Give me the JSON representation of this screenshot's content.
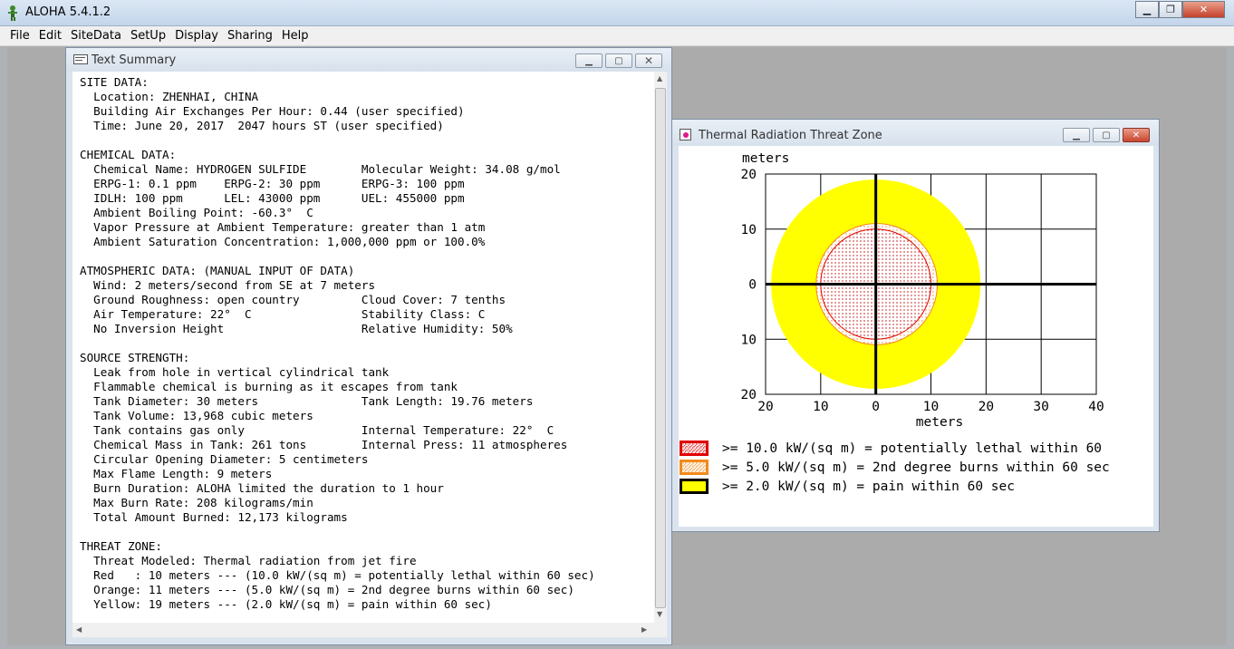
{
  "app": {
    "title": "ALOHA 5.4.1.2",
    "menu": [
      "File",
      "Edit",
      "SiteData",
      "SetUp",
      "Display",
      "Sharing",
      "Help"
    ]
  },
  "text_summary": {
    "title": "Text Summary",
    "lines": [
      "SITE DATA:",
      "  Location: ZHENHAI, CHINA",
      "  Building Air Exchanges Per Hour: 0.44 (user specified)",
      "  Time: June 20, 2017  2047 hours ST (user specified)",
      "",
      "CHEMICAL DATA:",
      "  Chemical Name: HYDROGEN SULFIDE        Molecular Weight: 34.08 g/mol",
      "  ERPG-1: 0.1 ppm    ERPG-2: 30 ppm      ERPG-3: 100 ppm",
      "  IDLH: 100 ppm      LEL: 43000 ppm      UEL: 455000 ppm",
      "  Ambient Boiling Point: -60.3°  C",
      "  Vapor Pressure at Ambient Temperature: greater than 1 atm",
      "  Ambient Saturation Concentration: 1,000,000 ppm or 100.0%",
      "",
      "ATMOSPHERIC DATA: (MANUAL INPUT OF DATA)",
      "  Wind: 2 meters/second from SE at 7 meters",
      "  Ground Roughness: open country         Cloud Cover: 7 tenths",
      "  Air Temperature: 22°  C                Stability Class: C",
      "  No Inversion Height                    Relative Humidity: 50%",
      "",
      "SOURCE STRENGTH:",
      "  Leak from hole in vertical cylindrical tank",
      "  Flammable chemical is burning as it escapes from tank",
      "  Tank Diameter: 30 meters               Tank Length: 19.76 meters",
      "  Tank Volume: 13,968 cubic meters",
      "  Tank contains gas only                 Internal Temperature: 22°  C",
      "  Chemical Mass in Tank: 261 tons        Internal Press: 11 atmospheres",
      "  Circular Opening Diameter: 5 centimeters",
      "  Max Flame Length: 9 meters",
      "  Burn Duration: ALOHA limited the duration to 1 hour",
      "  Max Burn Rate: 208 kilograms/min",
      "  Total Amount Burned: 12,173 kilograms",
      "",
      "THREAT ZONE:",
      "  Threat Modeled: Thermal radiation from jet fire",
      "  Red   : 10 meters --- (10.0 kW/(sq m) = potentially lethal within 60 sec)",
      "  Orange: 11 meters --- (5.0 kW/(sq m) = 2nd degree burns within 60 sec)",
      "  Yellow: 19 meters --- (2.0 kW/(sq m) = pain within 60 sec)"
    ]
  },
  "thermal": {
    "title": "Thermal Radiation Threat Zone",
    "legend": [
      {
        "label": ">= 10.0 kW/(sq m) = potentially lethal within 60",
        "border": "#e00000",
        "fill": "dots-red"
      },
      {
        "label": ">= 5.0 kW/(sq m) = 2nd degree burns within 60 sec",
        "border": "#f28a1c",
        "fill": "dots-orange"
      },
      {
        "label": ">= 2.0 kW/(sq m) = pain within 60 sec",
        "border": "#000000",
        "fill": "#ffff00"
      }
    ]
  },
  "chart_data": {
    "type": "scatter",
    "title": "",
    "xlabel": "meters",
    "ylabel": "meters",
    "xlim": [
      -20,
      40
    ],
    "ylim": [
      -20,
      20
    ],
    "x_ticks": [
      "20",
      "10",
      "0",
      "10",
      "20",
      "30",
      "40"
    ],
    "y_ticks": [
      "20",
      "10",
      "0",
      "10",
      "20"
    ],
    "grid": true,
    "zones": [
      {
        "name": "Red",
        "radius_m": 10,
        "center": [
          0,
          0
        ],
        "color": "#e00000"
      },
      {
        "name": "Orange",
        "radius_m": 11,
        "center": [
          0,
          0
        ],
        "color": "#f28a1c"
      },
      {
        "name": "Yellow",
        "radius_m": 19,
        "center": [
          0,
          0
        ],
        "color": "#ffff00"
      }
    ]
  }
}
